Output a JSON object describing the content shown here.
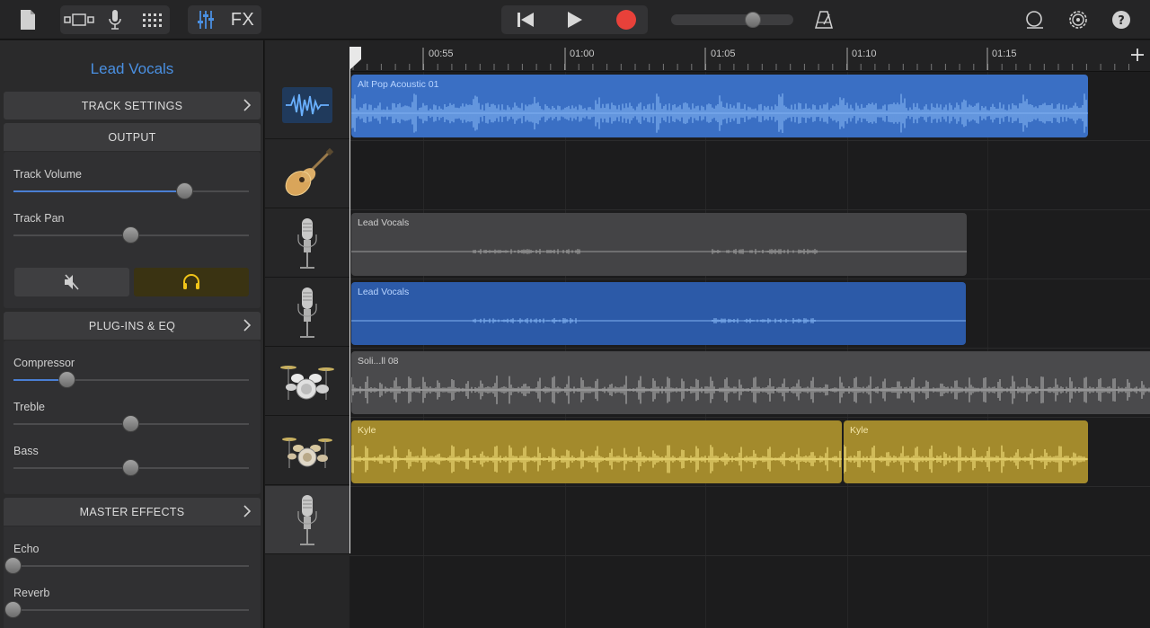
{
  "toolbar": {
    "fx_label": "FX",
    "icons": [
      "document-icon",
      "views-icon",
      "mic-icon",
      "grid-icon",
      "mixer-icon",
      "rewind-icon",
      "play-icon",
      "record-icon",
      "metronome-icon",
      "loop-icon",
      "settings-icon",
      "help-icon"
    ],
    "record_color": "#e8413a",
    "master_volume": 0.67
  },
  "inspector": {
    "title": "Lead Vocals",
    "track_settings": "TRACK SETTINGS",
    "output": {
      "header": "OUTPUT",
      "track_volume_label": "Track Volume",
      "track_volume": 0.73,
      "track_pan_label": "Track Pan",
      "track_pan": 0.5
    },
    "plugins": {
      "header": "PLUG-INS & EQ",
      "compressor_label": "Compressor",
      "compressor": 0.23,
      "treble_label": "Treble",
      "treble": 0.5,
      "bass_label": "Bass",
      "bass": 0.5
    },
    "master_effects": {
      "header": "MASTER EFFECTS",
      "echo_label": "Echo",
      "echo": 0.0,
      "reverb_label": "Reverb",
      "reverb": 0.0
    }
  },
  "tracks": [
    {
      "icon": "waveform-track-icon"
    },
    {
      "icon": "guitar-icon"
    },
    {
      "icon": "microphone-icon"
    },
    {
      "icon": "microphone-icon"
    },
    {
      "icon": "drum-kit-icon"
    },
    {
      "icon": "drum-kit-icon"
    },
    {
      "icon": "microphone-icon",
      "selected": true
    }
  ],
  "ruler": {
    "labels": [
      "00:55",
      "01:00",
      "01:05",
      "01:10",
      "01:15"
    ]
  },
  "regions": [
    {
      "label": "Alt Pop Acoustic 01",
      "color": "#3a6fc4",
      "wave": "#7fb0f0"
    },
    {
      "label": "Lead Vocals",
      "color": "#444446",
      "wave": "#9a9a9a"
    },
    {
      "label": "Lead Vocals",
      "color": "#2c5aa8",
      "wave": "#7fb0f0"
    },
    {
      "label": "Soli...ll 08",
      "color": "#4a4a4c",
      "wave": "#a8a8a8"
    },
    {
      "label": "Kyle",
      "color": "#a38a2c",
      "wave": "#f0dc78"
    },
    {
      "label": "Kyle",
      "color": "#a38a2c",
      "wave": "#f0dc78"
    }
  ]
}
